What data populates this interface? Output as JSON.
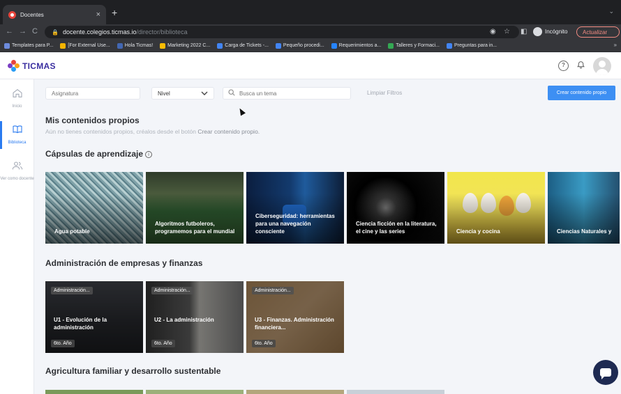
{
  "browser": {
    "tab_title": "Docentes",
    "tab_close": "×",
    "new_tab": "+",
    "tab_menu": "⌄",
    "back": "←",
    "forward": "→",
    "reload": "C",
    "url_host": "docente.colegios.ticmas.io",
    "url_path": "/director/biblioteca",
    "profile_label": "Incógnito",
    "update_label": "Actualizar",
    "bookmarks": [
      {
        "label": "Templates para P...",
        "color": "#6d8bdc"
      },
      {
        "label": "[For External Use...",
        "color": "#f4b400"
      },
      {
        "label": "Hola Ticmas!",
        "color": "#4267b2"
      },
      {
        "label": "Marketing 2022 C...",
        "color": "#fbbc04"
      },
      {
        "label": "Carga de Tickets -...",
        "color": "#4285f4"
      },
      {
        "label": "Pequeño procedi...",
        "color": "#4285f4"
      },
      {
        "label": "Requerimientos a...",
        "color": "#2684ff"
      },
      {
        "label": "Talleres y Formaci...",
        "color": "#34a853"
      },
      {
        "label": "Preguntas para in...",
        "color": "#4285f4"
      }
    ],
    "bookmarks_more": "»"
  },
  "app": {
    "logo_text": "TICMAS",
    "help_icon": "?",
    "bell_icon": "🔔"
  },
  "sidebar": {
    "items": [
      {
        "label": "Inicio",
        "icon": "⌂"
      },
      {
        "label": "Biblioteca",
        "icon": "📖"
      },
      {
        "label": "Ver como docente",
        "icon": "👥"
      }
    ]
  },
  "filters": {
    "subject_placeholder": "Asignatura",
    "level_value": "Nivel",
    "search_placeholder": "Busca un tema",
    "clear_label": "Limpiar Filtros",
    "create_label": "Crear contenido propio"
  },
  "own_content": {
    "title": "Mis contenidos propios",
    "subtitle": "Aún no tienes contenidos propios, créalos desde el botón ",
    "subtitle_bold": "Crear contenido propio."
  },
  "capsules": {
    "title": "Cápsulas de aprendizaje",
    "info_icon": "i",
    "items": [
      "Agua potable",
      "Algoritmos futboleros, programemos para el mundial",
      "Ciberseguridad: herramientas para una navegación consciente",
      "Ciencia ficción en la literatura, el cine y las series",
      "Ciencia y cocina",
      "Ciencias Naturales y"
    ]
  },
  "business": {
    "title": "Administración de empresas y finanzas",
    "items": [
      {
        "tag": "Administración...",
        "title": "U1 - Evolución de la administración",
        "year": "6to. Año"
      },
      {
        "tag": "Administración...",
        "title": "U2 - La administración",
        "year": "6to. Año"
      },
      {
        "tag": "Administración...",
        "title": "U3 - Finanzas. Administración financiera...",
        "year": "6to. Año"
      }
    ]
  },
  "agriculture": {
    "title": "Agricultura familiar y desarrollo sustentable"
  }
}
